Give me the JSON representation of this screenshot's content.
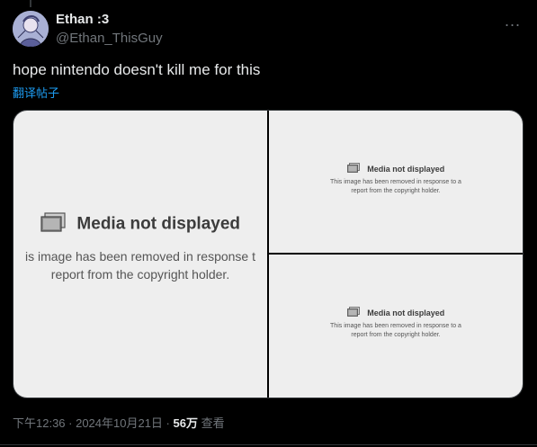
{
  "post": {
    "author_name": "Ethan :3",
    "author_handle": "@Ethan_ThisGuy",
    "more_icon": "...",
    "text": "hope nintendo doesn't kill me for this",
    "translate_label": "翻译帖子",
    "timestamp": "下午12:36 · 2024年10月21日 · ",
    "views_count": "56万",
    "views_label": " 查看"
  },
  "media": {
    "placeholders": [
      {
        "title": "Media not displayed",
        "body_line1": "is image has been removed in response t",
        "body_line2": "report from the copyright holder."
      },
      {
        "title": "Media not displayed",
        "body_line1": "This image has been removed in response to a",
        "body_line2": "report from the copyright holder."
      },
      {
        "title": "Media not displayed",
        "body_line1": "This image has been removed in response to a",
        "body_line2": "report from the copyright holder."
      }
    ]
  },
  "colors": {
    "background": "#000000",
    "text_primary": "#e7e9ea",
    "text_secondary": "#71767b",
    "link": "#1d9bf0",
    "placeholder_bg": "#eeeeee"
  }
}
